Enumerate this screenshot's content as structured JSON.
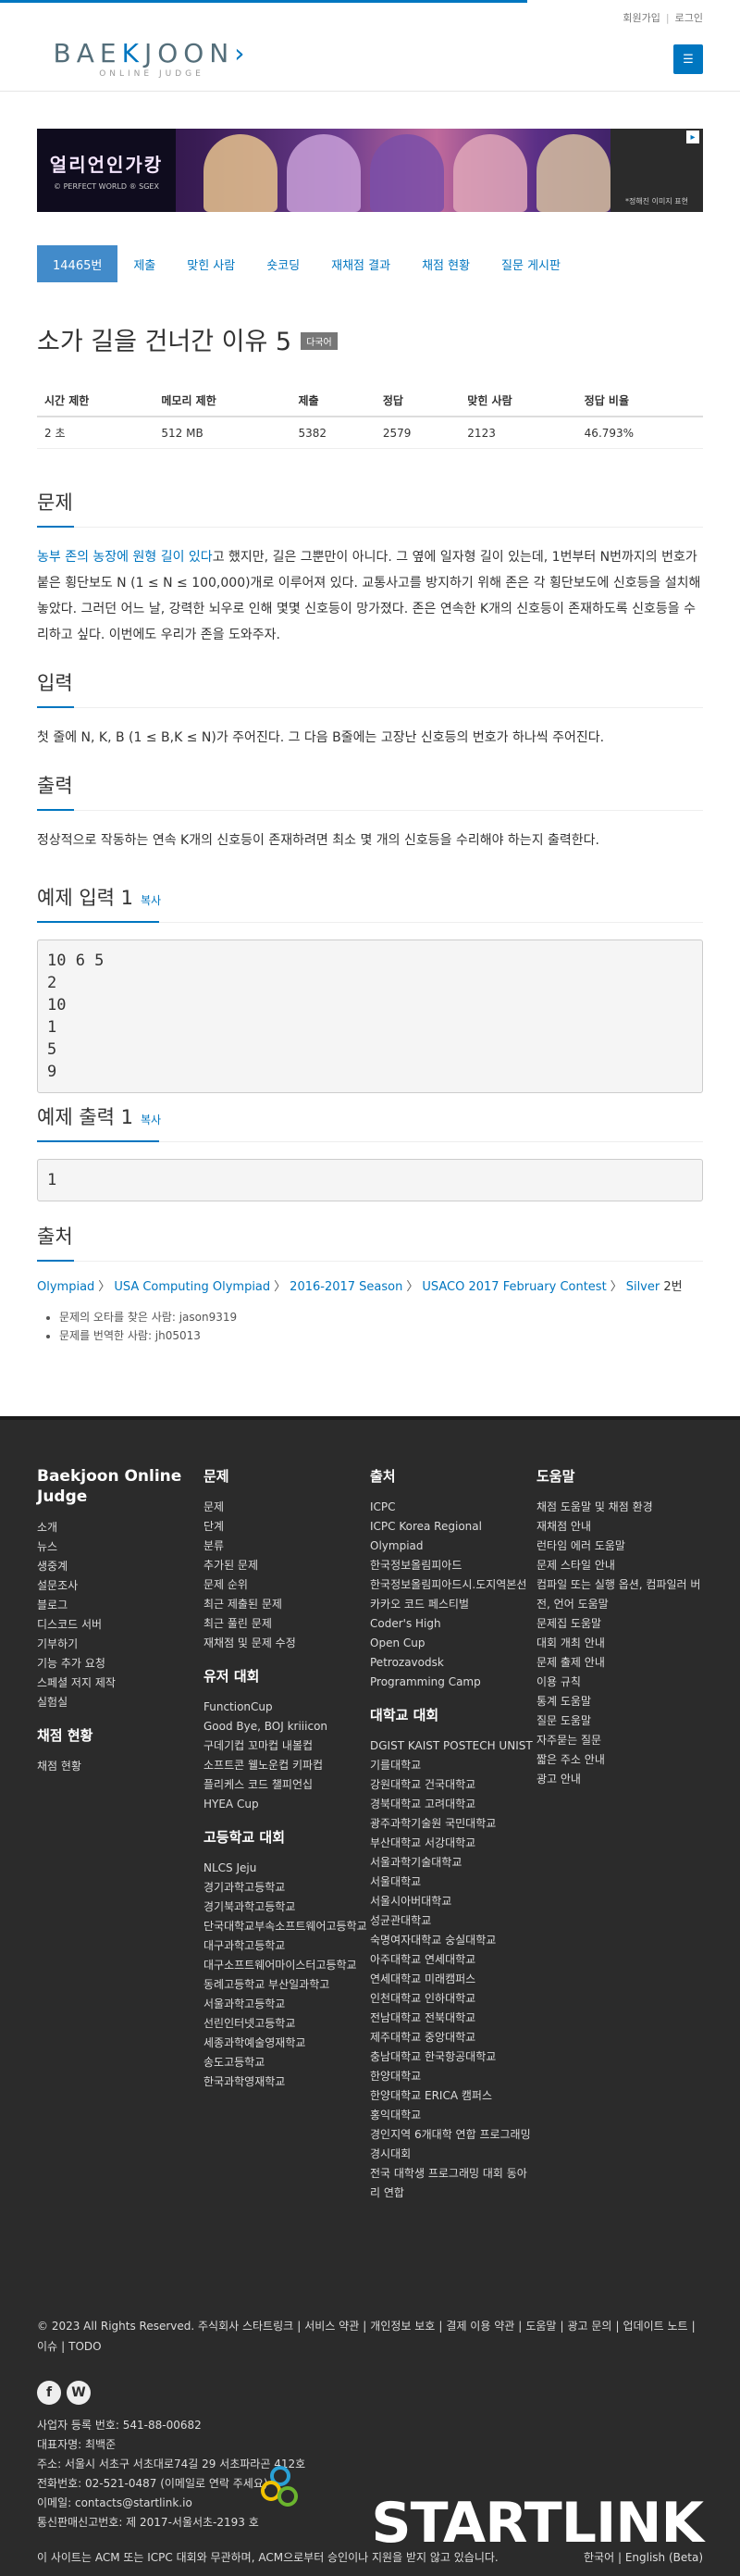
{
  "user": {
    "signup": "회원가입",
    "sep": "|",
    "login": "로그인"
  },
  "logo": {
    "main_a": "BAE",
    "main_k": "K",
    "main_b": "JOON",
    "arrow": "›",
    "sub": "ONLINE JUDGE"
  },
  "menu_icon": "bars-icon",
  "banner": {
    "title": "얼리언인가캉",
    "sub": "© PERFECT WORLD ® SGEX",
    "right": "*정해진 이미지 표현"
  },
  "tabs": [
    "14465번",
    "제출",
    "맞힌 사람",
    "숏코딩",
    "재채점 결과",
    "채점 현황",
    "질문 게시판"
  ],
  "problem": {
    "title": "소가 길을 건너간 이유 5",
    "lang_label": "다국어",
    "info_headers": [
      "시간 제한",
      "메모리 제한",
      "제출",
      "정답",
      "맞힌 사람",
      "정답 비율"
    ],
    "info_values": [
      "2 초",
      "512 MB",
      "5382",
      "2579",
      "2123",
      "46.793%"
    ]
  },
  "sections": {
    "desc_h": "문제",
    "desc_link": "농부 존의 농장에 원형 길이 있다",
    "desc_rest": "고 했지만, 길은 그뿐만이 아니다. 그 옆에 일자형 길이 있는데, 1번부터 N번까지의 번호가 붙은 횡단보도 N (1 ≤ N ≤ 100,000)개로 이루어져 있다. 교통사고를 방지하기 위해 존은 각 횡단보도에 신호등을 설치해 놓았다. 그러던 어느 날, 강력한 뇌우로 인해 몇몇 신호등이 망가졌다. 존은 연속한 K개의 신호등이 존재하도록 신호등을 수리하고 싶다. 이번에도 우리가 존을 도와주자.",
    "input_h": "입력",
    "input_text": "첫 줄에 N, K, B (1 ≤ B,K ≤ N)가 주어진다. 그 다음 B줄에는 고장난 신호등의 번호가 하나씩 주어진다.",
    "output_h": "출력",
    "output_text": "정상적으로 작동하는 연속 K개의 신호등이 존재하려면 최소 몇 개의 신호등을 수리해야 하는지 출력한다.",
    "sample_in_h": "예제 입력 1",
    "sample_in": "10 6 5\n2\n10\n1\n5\n9",
    "sample_out_h": "예제 출력 1",
    "sample_out": "1",
    "copy": "복사",
    "source_h": "출처",
    "crumbs": [
      "Olympiad",
      "USA Computing Olympiad",
      "2016-2017 Season",
      "USACO 2017 February Contest",
      "Silver"
    ],
    "crumb_num": "2번",
    "bullets": [
      "문제의 오타를 찾은 사람: jason9319",
      "문제를 번역한 사람: jh05013"
    ]
  },
  "footer": {
    "col1_title": "Baekjoon Online Judge",
    "col1": [
      "소개",
      "뉴스",
      "생중계",
      "설문조사",
      "블로그",
      "디스코드 서버",
      "기부하기",
      "기능 추가 요청",
      "스페셜 저지 제작",
      "실험실"
    ],
    "col1b_title": "채점 현황",
    "col1b": [
      "채점 현황"
    ],
    "col2_title": "문제",
    "col2": [
      "문제",
      "단계",
      "분류",
      "추가된 문제",
      "문제 순위",
      "최근 제출된 문제",
      "최근 풀린 문제",
      "재채점 및 문제 수정"
    ],
    "col2b_title": "유저 대회",
    "col2b": [
      "FunctionCup",
      "Good Bye, BOJ kriiicon",
      "구데기컵 꼬마컵 내볼컵",
      "소프트콘 웰노운컵 키파컵",
      "플리케스 코드 챌피언십",
      "HYEA Cup"
    ],
    "col2c_title": "고등학교 대회",
    "col2c": [
      "NLCS Jeju",
      "경기과학고등학교",
      "경기북과학고등학교",
      "단국대학교부속소프트웨어고등학교",
      "대구과학고등학교",
      "대구소프트웨어마이스터고등학교",
      "동례고등학교 부산일과학고",
      "서울과학고등학교",
      "선린인터넷고등학교",
      "세종과학예술영재학교",
      "송도고등학교",
      "한국과학영재학교"
    ],
    "col3_title": "출처",
    "col3": [
      "ICPC",
      "ICPC Korea Regional",
      "Olympiad",
      "한국정보올림피아드",
      "한국정보올림피아드시.도지역본선",
      "카카오 코드 페스티벌",
      "Coder's High",
      "Open Cup",
      "Petrozavodsk",
      "Programming Camp"
    ],
    "col3b_title": "대학교 대회",
    "col3b": [
      "DGIST KAIST POSTECH UNIST 기를대학교",
      "강원대학교 건국대학교",
      "경북대학교 고려대학교",
      "광주과학기술원 국민대학교",
      "부산대학교 서강대학교",
      "서울과학기술대학교",
      "서울대학교",
      "서울시아버대학교",
      "성균관대학교",
      "숙명여자대학교 숭실대학교",
      "아주대학교 연세대학교",
      "연세대학교 미래캠퍼스",
      "인천대학교 인하대학교",
      "전남대학교 전북대학교",
      "제주대학교 중앙대학교",
      "충남대학교 한국항공대학교",
      "한양대학교",
      "한양대학교 ERICA 캠퍼스",
      "홍익대학교",
      "경인지역 6개대학 연합 프로그래밍 경시대회",
      "전국 대학생 프로그래밍 대회 동아리 연합"
    ],
    "col4_title": "도움말",
    "col4": [
      "채점 도움말 및 채점 환경",
      "재채점 안내",
      "런타임 에러 도움말",
      "문제 스타일 안내",
      "컴파일 또는 실행 옵션, 컴파일러 버전, 언어 도움말",
      "문제집 도움말",
      "대회 개최 안내",
      "문제 출제 안내",
      "이용 규칙",
      "통계 도움말",
      "질문 도움말",
      "자주묻는 질문",
      "짧은 주소 안내",
      "광고 안내"
    ],
    "copyright": "© 2023 All Rights Reserved. 주식회사 스타트링크",
    "links": [
      "서비스 약관",
      "개인정보 보호",
      "결제 이용 약관",
      "도움말",
      "광고 문의",
      "업데이트 노트",
      "이슈",
      "TODO"
    ],
    "social": [
      "facebook-icon",
      "wordpress-icon"
    ],
    "biz": [
      "사업자 등록 번호: 541-88-00682",
      "대표자명: 최백준",
      "주소: 서울시 서초구 서초대로74길 29 서초파라곤 412호",
      "전화번호: 02-521-0487 (이메일로 연락 주세요)",
      "이메일: contacts@startlink.io",
      "통신판매신고번호: 제 2017-서울서초-2193 호"
    ],
    "brand": "STARTLINK",
    "disclaimer": "이 사이트는 ACM 또는 ICPC 대회와 무관하며, ACM으로부터 승인이나 지원을 받지 않고 있습니다.",
    "lang_ko": "한국어",
    "lang_en": "English (Beta)"
  },
  "colors": {
    "accent": "#0076c0",
    "footer_bg": "#2b2b2b",
    "tab_active": "#428bca"
  }
}
